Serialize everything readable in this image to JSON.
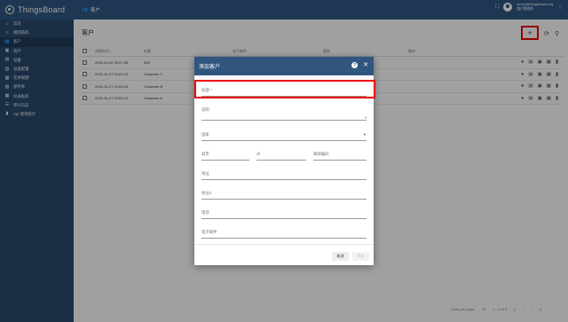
{
  "app": {
    "name": "ThingsBoard"
  },
  "sidebar": {
    "items": [
      {
        "label": "首页",
        "icon": "home-icon"
      },
      {
        "label": "规则链库",
        "icon": "code-icon"
      },
      {
        "label": "客户",
        "icon": "customers-icon",
        "active": true
      },
      {
        "label": "资产",
        "icon": "assets-icon"
      },
      {
        "label": "设备",
        "icon": "devices-icon"
      },
      {
        "label": "设备配置",
        "icon": "device-profile-icon"
      },
      {
        "label": "实体视图",
        "icon": "entity-view-icon"
      },
      {
        "label": "部件库",
        "icon": "widgets-icon"
      },
      {
        "label": "仪表板库",
        "icon": "dashboards-icon"
      },
      {
        "label": "审计日志",
        "icon": "audit-log-icon"
      },
      {
        "label": "Api 使用统计",
        "icon": "api-usage-icon"
      }
    ]
  },
  "header": {
    "title": "客户",
    "user_email": "tenant@thingsboard.org",
    "user_role": "租户管理员"
  },
  "page": {
    "title": "客户",
    "columns": [
      "创建时间 ↓",
      "标题",
      "电子邮件",
      "国家",
      "城市"
    ],
    "rows": [
      {
        "time": "2021-02-02 16:07:55",
        "title": "345",
        "email": "",
        "country": "",
        "city": ""
      },
      {
        "time": "2021-01-27 10:02:24",
        "title": "Customer C",
        "email": "",
        "country": "",
        "city": ""
      },
      {
        "time": "2021-01-27 10:02:24",
        "title": "Customer B",
        "email": "",
        "country": "",
        "city": ""
      },
      {
        "time": "2021-01-27 10:02:24",
        "title": "Customer A",
        "email": "",
        "country": "",
        "city": ""
      }
    ],
    "paginator": {
      "items_label": "Items per page:",
      "page_size": "20",
      "range": "1 – 4 of 4"
    }
  },
  "dialog": {
    "title": "添加客户",
    "fields": {
      "title": "标题 *",
      "description": "说明",
      "country": "国家",
      "city": "城市",
      "state": "州",
      "zip": "邮政编码",
      "address": "地址",
      "address2": "地址2",
      "phone": "电话",
      "email": "电子邮件"
    },
    "cancel": "取消",
    "add": "添加"
  }
}
